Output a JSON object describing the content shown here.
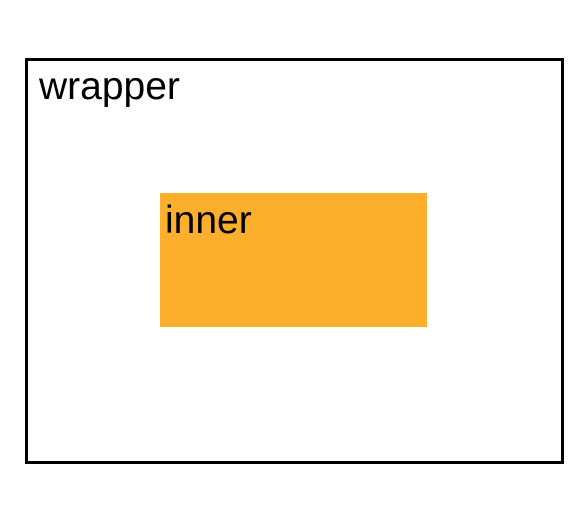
{
  "wrapper": {
    "label": "wrapper",
    "border_color": "#000000"
  },
  "inner": {
    "label": "inner",
    "background_color": "#fcaf2d"
  }
}
